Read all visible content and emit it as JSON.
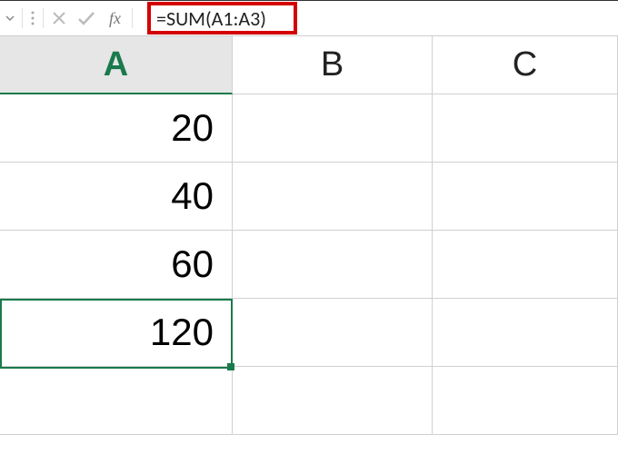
{
  "formula_bar": {
    "formula": "=SUM(A1:A3)",
    "fx_label": "fx"
  },
  "columns": [
    {
      "label": "A",
      "selected": true
    },
    {
      "label": "B",
      "selected": false
    },
    {
      "label": "C",
      "selected": false
    }
  ],
  "cells": {
    "A1": "20",
    "A2": "40",
    "A3": "60",
    "A4": "120"
  },
  "active_cell": "A4"
}
